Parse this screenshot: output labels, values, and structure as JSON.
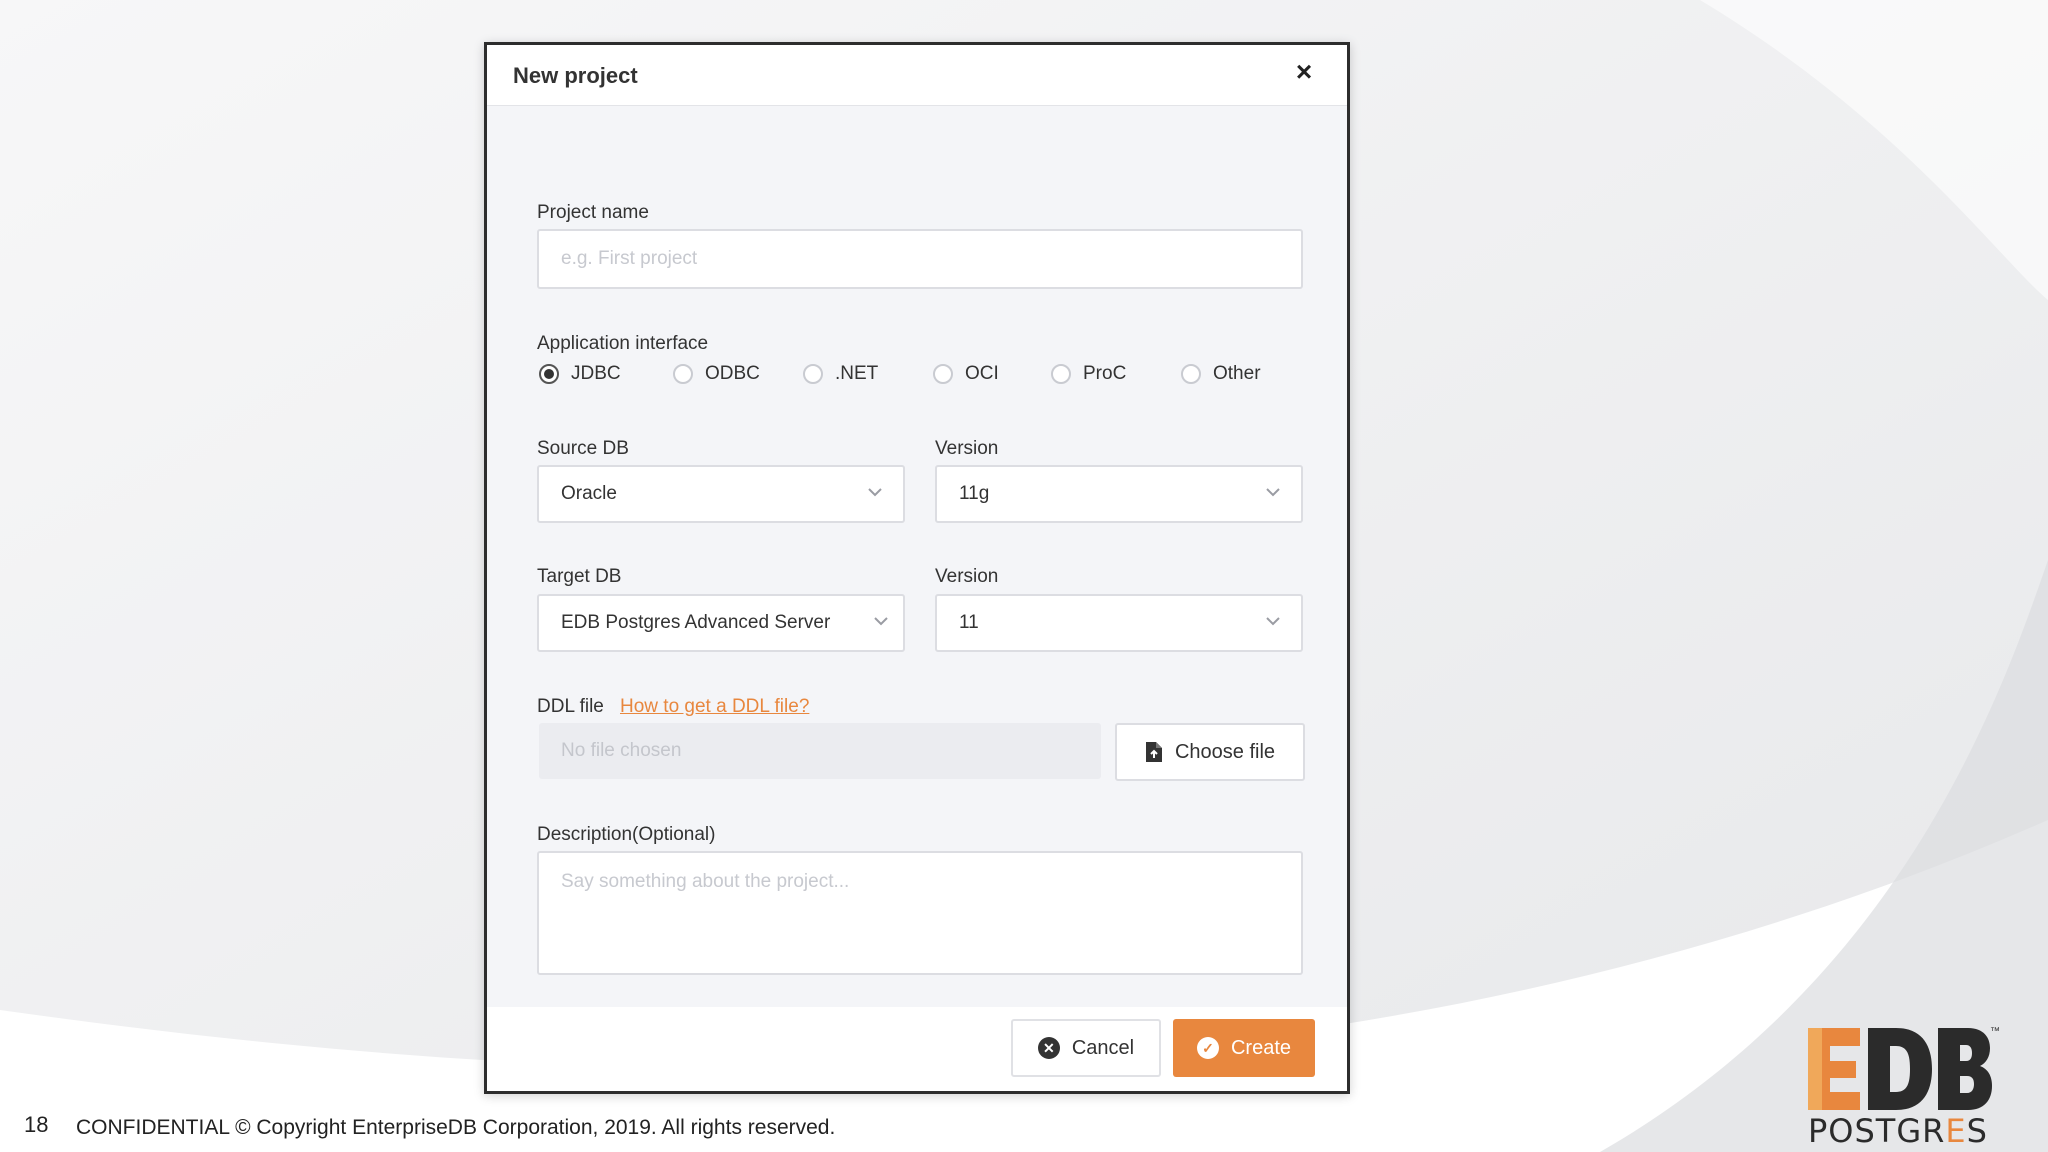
{
  "dialog": {
    "title": "New project",
    "close_icon": "close-icon",
    "project_name": {
      "label": "Project name",
      "placeholder": "e.g. First project"
    },
    "application_interface": {
      "label": "Application interface",
      "options": [
        "JDBC",
        "ODBC",
        ".NET",
        "OCI",
        "ProC",
        "Other"
      ],
      "selected": "JDBC"
    },
    "source_db": {
      "label": "Source DB",
      "value": "Oracle"
    },
    "source_version": {
      "label": "Version",
      "value": "11g"
    },
    "target_db": {
      "label": "Target DB",
      "value": "EDB Postgres Advanced Server"
    },
    "target_version": {
      "label": "Version",
      "value": "11"
    },
    "ddl_file": {
      "label": "DDL file",
      "help_link": "How to get a DDL file?",
      "placeholder": "No file chosen",
      "choose_label": "Choose file",
      "choose_icon": "file-upload-icon"
    },
    "description": {
      "label": "Description(Optional)",
      "placeholder": "Say something about the project..."
    },
    "footer": {
      "cancel_label": "Cancel",
      "cancel_icon": "x-circle-icon",
      "create_label": "Create",
      "create_icon": "check-circle-icon"
    }
  },
  "slide": {
    "page_number": "18",
    "copyright": "CONFIDENTIAL © Copyright EnterpriseDB Corporation, 2019. All rights reserved.",
    "logo": {
      "wordmark": "EDB",
      "subtext_pre": "POSTGR",
      "subtext_accent": "E",
      "subtext_post": "S",
      "tm": "™"
    }
  },
  "colors": {
    "accent": "#e8873e",
    "text": "#333333",
    "dialog_bg": "#f4f5f8",
    "border": "#dcdde2"
  }
}
